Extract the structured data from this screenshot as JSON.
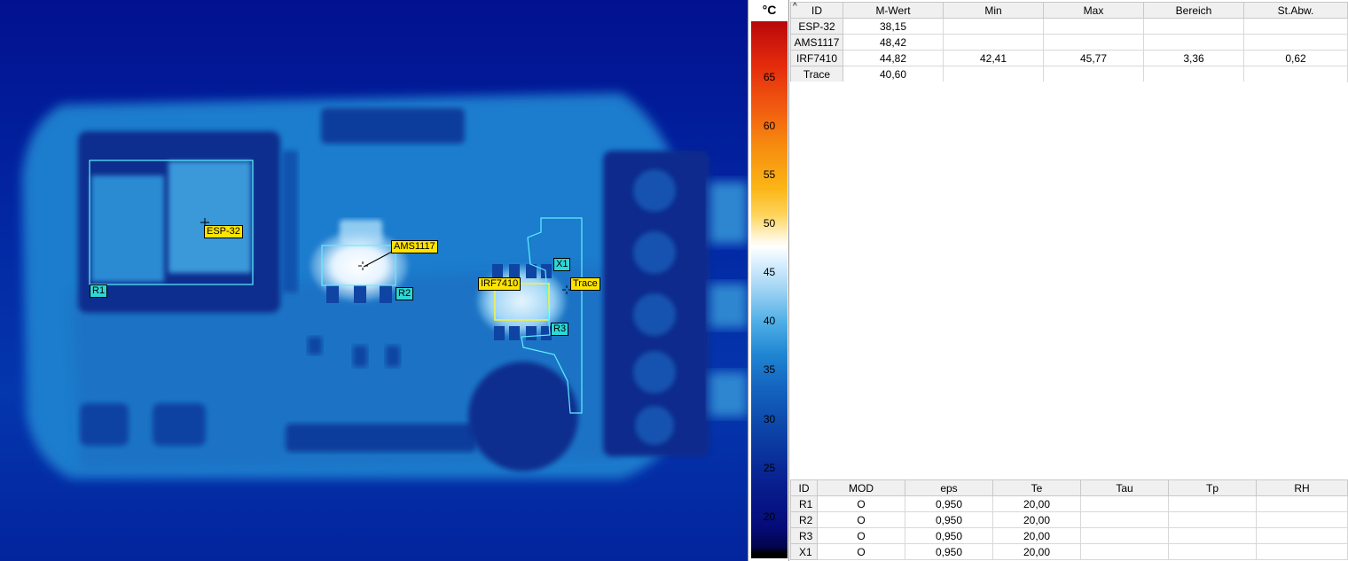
{
  "thermal_image": {
    "labels": {
      "esp32": "ESP-32",
      "ams1117": "AMS1117",
      "irf7410": "IRF7410",
      "trace": "Trace",
      "r1": "R1",
      "r2": "R2",
      "r3": "R3",
      "x1": "X1"
    },
    "colors": {
      "measure_tag": "#ffe400",
      "region_tag": "#2fd6d6",
      "roi_outline": "#5ef0ff",
      "hot_roi": "#f5f53a"
    }
  },
  "scale": {
    "unit": "°C",
    "ticks": [
      "65",
      "60",
      "55",
      "50",
      "45",
      "40",
      "35",
      "30",
      "25",
      "20"
    ]
  },
  "measurements": {
    "columns": [
      "ID",
      "M-Wert",
      "Min",
      "Max",
      "Bereich",
      "St.Abw."
    ],
    "rows": [
      [
        "ESP-32",
        "38,15",
        "",
        "",
        "",
        ""
      ],
      [
        "AMS1117",
        "48,42",
        "",
        "",
        "",
        ""
      ],
      [
        "IRF7410",
        "44,82",
        "42,41",
        "45,77",
        "3,36",
        "0,62"
      ],
      [
        "Trace",
        "40,60",
        "",
        "",
        "",
        ""
      ]
    ]
  },
  "parameters": {
    "columns": [
      "ID",
      "MOD",
      "eps",
      "Te",
      "Tau",
      "Tp",
      "RH"
    ],
    "rows": [
      [
        "R1",
        "O",
        "0,950",
        "20,00",
        "",
        "",
        ""
      ],
      [
        "R2",
        "O",
        "0,950",
        "20,00",
        "",
        "",
        ""
      ],
      [
        "R3",
        "O",
        "0,950",
        "20,00",
        "",
        "",
        ""
      ],
      [
        "X1",
        "O",
        "0,950",
        "20,00",
        "",
        "",
        ""
      ]
    ]
  }
}
